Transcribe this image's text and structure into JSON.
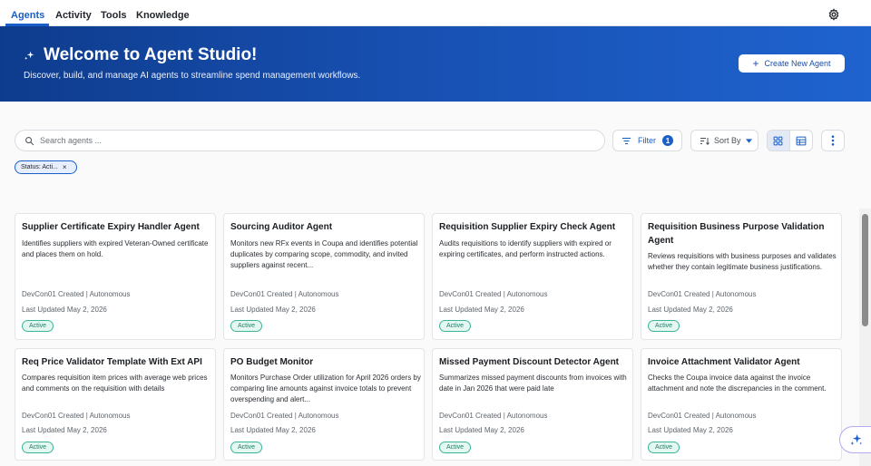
{
  "nav": {
    "tabs": [
      {
        "label": "Agents",
        "active": true
      },
      {
        "label": "Activity"
      },
      {
        "label": "Tools"
      },
      {
        "label": "Knowledge"
      }
    ],
    "settings_icon": "gear-icon"
  },
  "hero": {
    "icon": "sparkle-icon",
    "title": "Welcome to Agent Studio!",
    "subtitle": "Discover, build, and manage AI agents to streamline spend management workflows.",
    "create_label": "Create New Agent"
  },
  "toolbar": {
    "search_placeholder": "Search agents ...",
    "filter_label": "Filter",
    "filter_count": "1",
    "sort_label": "Sort By",
    "view_mode": "grid"
  },
  "active_filter": {
    "label": "Status: Acti..."
  },
  "colors": {
    "accent": "#1a5fc8",
    "hero_start": "#0e3c8d",
    "hero_end": "#1f63cf",
    "active_badge": "#3bb59a"
  },
  "cards": [
    {
      "title": "Supplier Certificate Expiry Handler Agent",
      "description": "Identifies suppliers with expired Veteran-Owned certificate and places them on hold.",
      "created": "DevCon01 Created | Autonomous",
      "updated": "Last Updated May 2, 2026",
      "status": "Active"
    },
    {
      "title": "Sourcing Auditor Agent",
      "description": "Monitors new RFx events in Coupa and identifies potential duplicates by comparing scope, commodity, and invited suppliers against recent...",
      "created": "DevCon01 Created | Autonomous",
      "updated": "Last Updated May 2, 2026",
      "status": "Active"
    },
    {
      "title": "Requisition Supplier Expiry Check Agent",
      "description": "Audits requisitions to identify suppliers with expired or expiring certificates, and perform instructed actions.",
      "created": "DevCon01 Created | Autonomous",
      "updated": "Last Updated May 2, 2026",
      "status": "Active"
    },
    {
      "title": "Requisition Business Purpose Validation Agent",
      "description": "Reviews requisitions with business purposes and validates whether they contain legitimate business justifications.",
      "created": "DevCon01 Created | Autonomous",
      "updated": "Last Updated May 2, 2026",
      "status": "Active"
    },
    {
      "title": "Req Price Validator Template With Ext API",
      "description": "Compares requisition item prices with average web prices and comments on the requisition with details",
      "created": "DevCon01 Created | Autonomous",
      "updated": "Last Updated May 2, 2026",
      "status": "Active"
    },
    {
      "title": "PO Budget Monitor",
      "description": "Monitors Purchase Order utilization for April 2026 orders by comparing line amounts against invoice totals to prevent overspending and alert...",
      "created": "DevCon01 Created | Autonomous",
      "updated": "Last Updated May 2, 2026",
      "status": "Active"
    },
    {
      "title": "Missed Payment Discount Detector Agent",
      "description": "Summarizes missed payment discounts from invoices with date in Jan 2026 that were paid late",
      "created": "DevCon01 Created | Autonomous",
      "updated": "Last Updated May 2, 2026",
      "status": "Active"
    },
    {
      "title": "Invoice Attachment Validator Agent",
      "description": "Checks the Coupa invoice data against the invoice attachment and note the discrepancies in the comment.",
      "created": "DevCon01 Created | Autonomous",
      "updated": "Last Updated May 2, 2026",
      "status": "Active"
    }
  ]
}
